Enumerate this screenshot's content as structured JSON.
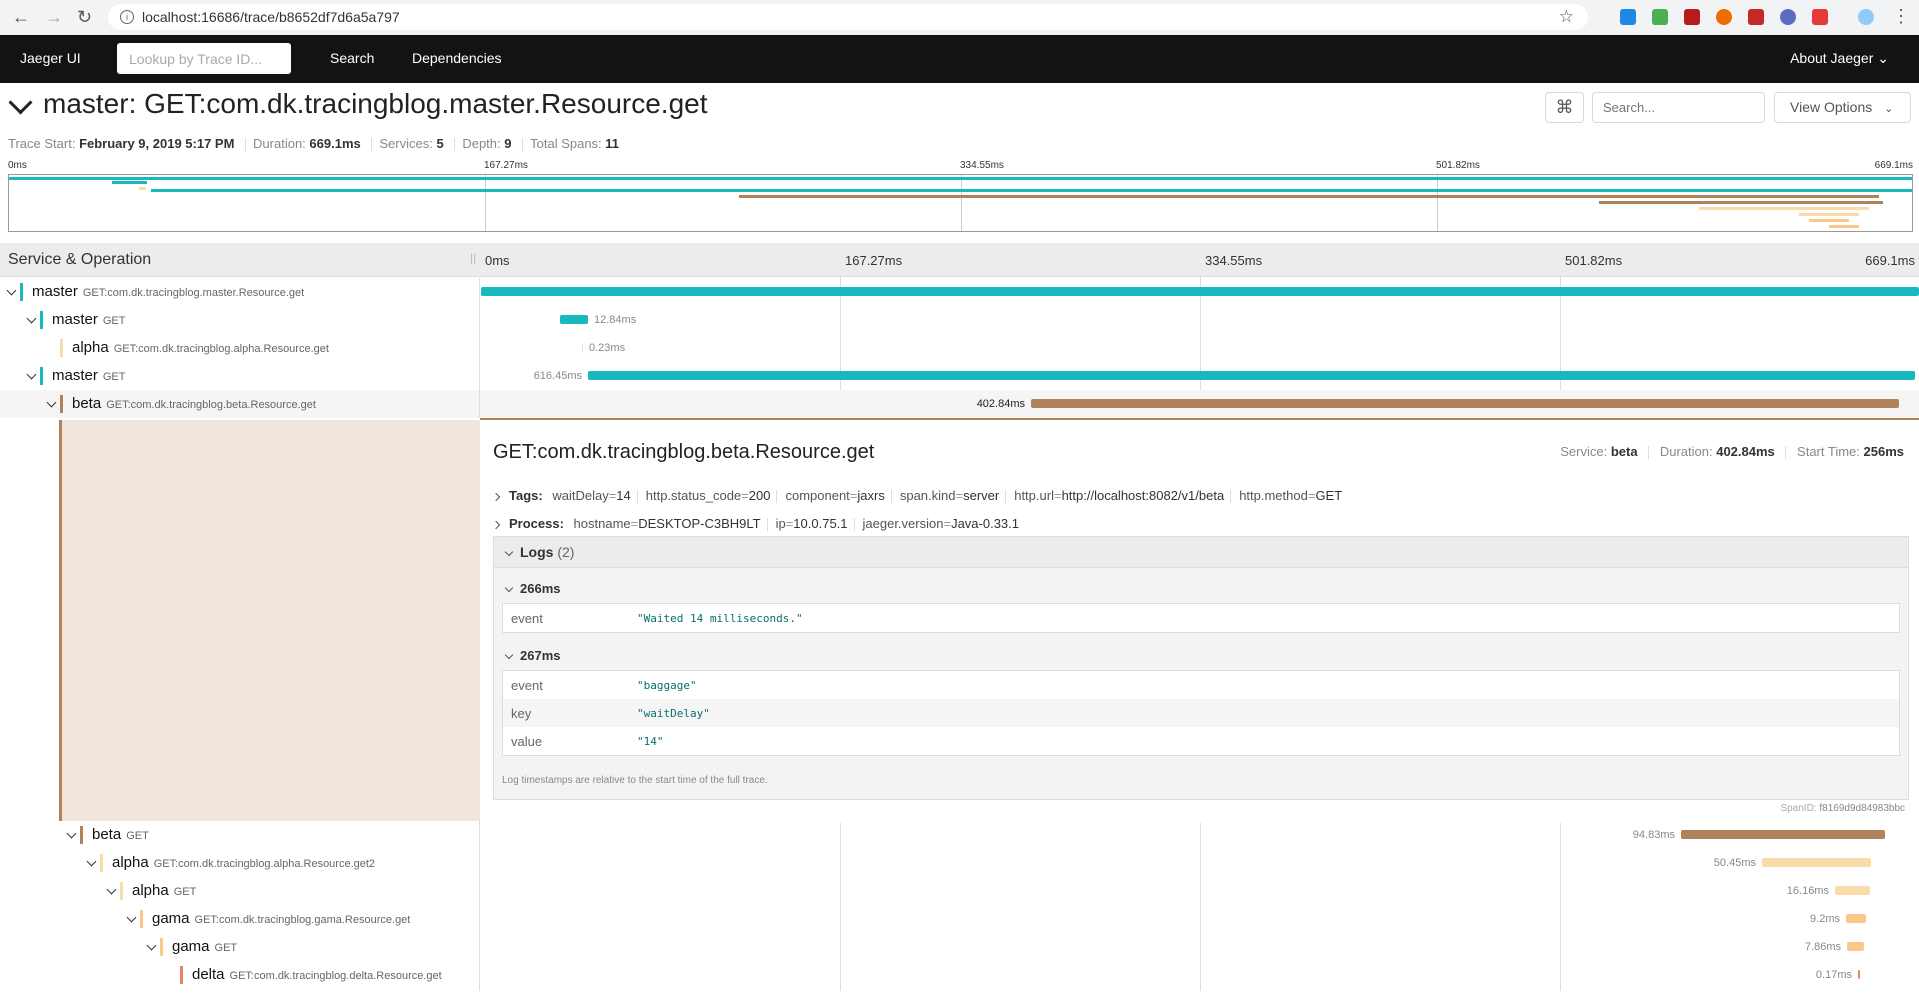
{
  "browser": {
    "url": "localhost:16686/trace/b8652df7d6a5a797"
  },
  "nav": {
    "brand": "Jaeger UI",
    "lookup_placeholder": "Lookup by Trace ID...",
    "search": "Search",
    "dependencies": "Dependencies",
    "about": "About Jaeger"
  },
  "trace": {
    "title": "master: GET:com.dk.tracingblog.master.Resource.get",
    "search_placeholder": "Search...",
    "view_options": "View Options",
    "start_label": "Trace Start:",
    "start": "February 9, 2019 5:17 PM",
    "duration_label": "Duration:",
    "duration": "669.1ms",
    "services_label": "Services:",
    "services": "5",
    "depth_label": "Depth:",
    "depth": "9",
    "spans_label": "Total Spans:",
    "spans": "11"
  },
  "timeline": {
    "header": "Service & Operation",
    "ticks": [
      "0ms",
      "167.27ms",
      "334.55ms",
      "501.82ms",
      "669.1ms"
    ]
  },
  "colors": {
    "master": "#17b8be",
    "alpha": "#f8dcaa",
    "beta": "#b0825a",
    "gama": "#fbc889",
    "delta": "#e2856c"
  },
  "spans": [
    {
      "service": "master",
      "op": "GET:com.dk.tracingblog.master.Resource.get",
      "duration": ""
    },
    {
      "service": "master",
      "op": "GET",
      "duration": "12.84ms"
    },
    {
      "service": "alpha",
      "op": "GET:com.dk.tracingblog.alpha.Resource.get",
      "duration": "0.23ms"
    },
    {
      "service": "master",
      "op": "GET",
      "duration": "616.45ms"
    },
    {
      "service": "beta",
      "op": "GET:com.dk.tracingblog.beta.Resource.get",
      "duration": "402.84ms"
    },
    {
      "service": "beta",
      "op": "GET",
      "duration": "94.83ms"
    },
    {
      "service": "alpha",
      "op": "GET:com.dk.tracingblog.alpha.Resource.get2",
      "duration": "50.45ms"
    },
    {
      "service": "alpha",
      "op": "GET",
      "duration": "16.16ms"
    },
    {
      "service": "gama",
      "op": "GET:com.dk.tracingblog.gama.Resource.get",
      "duration": "9.2ms"
    },
    {
      "service": "gama",
      "op": "GET",
      "duration": "7.86ms"
    },
    {
      "service": "delta",
      "op": "GET:com.dk.tracingblog.delta.Resource.get",
      "duration": "0.17ms"
    }
  ],
  "detail": {
    "title": "GET:com.dk.tracingblog.beta.Resource.get",
    "service_label": "Service:",
    "service": "beta",
    "duration_label": "Duration:",
    "duration": "402.84ms",
    "start_label": "Start Time:",
    "start": "256ms",
    "tags_label": "Tags:",
    "tags": [
      {
        "k": "waitDelay",
        "v": "14"
      },
      {
        "k": "http.status_code",
        "v": "200"
      },
      {
        "k": "component",
        "v": "jaxrs"
      },
      {
        "k": "span.kind",
        "v": "server"
      },
      {
        "k": "http.url",
        "v": "http://localhost:8082/v1/beta"
      },
      {
        "k": "http.method",
        "v": "GET"
      }
    ],
    "process_label": "Process:",
    "process": [
      {
        "k": "hostname",
        "v": "DESKTOP-C3BH9LT"
      },
      {
        "k": "ip",
        "v": "10.0.75.1"
      },
      {
        "k": "jaeger.version",
        "v": "Java-0.33.1"
      }
    ],
    "logs_label": "Logs",
    "logs_count": "(2)",
    "logs": [
      {
        "time": "266ms",
        "fields": [
          {
            "k": "event",
            "v": "\"Waited 14 milliseconds.\""
          }
        ]
      },
      {
        "time": "267ms",
        "fields": [
          {
            "k": "event",
            "v": "\"baggage\""
          },
          {
            "k": "key",
            "v": "\"waitDelay\""
          },
          {
            "k": "value",
            "v": "\"14\""
          }
        ]
      }
    ],
    "log_note": "Log timestamps are relative to the start time of the full trace.",
    "spanid_label": "SpanID:",
    "spanid": "f8169d9d84983bbc"
  }
}
